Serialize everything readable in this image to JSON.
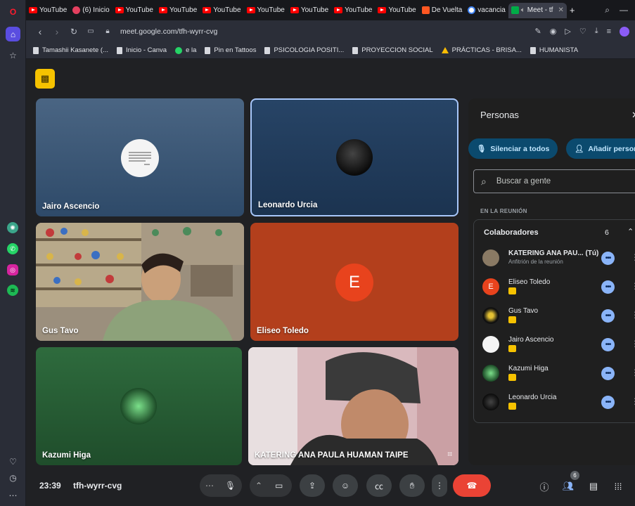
{
  "browser": {
    "tabs": [
      {
        "label": "YouTube",
        "kind": "youtube"
      },
      {
        "label": "(6) Inicio",
        "kind": "other"
      },
      {
        "label": "YouTube",
        "kind": "youtube"
      },
      {
        "label": "YouTube",
        "kind": "youtube"
      },
      {
        "label": "YouTube",
        "kind": "youtube"
      },
      {
        "label": "YouTube",
        "kind": "youtube"
      },
      {
        "label": "YouTube",
        "kind": "youtube"
      },
      {
        "label": "YouTube",
        "kind": "youtube"
      },
      {
        "label": "YouTube",
        "kind": "youtube"
      },
      {
        "label": "De Vuelta",
        "kind": "other"
      },
      {
        "label": "vacancia",
        "kind": "google"
      },
      {
        "label": "Meet - tf",
        "kind": "meet",
        "active": true
      }
    ],
    "url": "meet.google.com/tfh-wyrr-cvg",
    "bookmarks": [
      "Tamashii Kasanete (...",
      "Inicio - Canva",
      "e la",
      "Pin en Tattoos",
      "PSICOLOGIA POSITI...",
      "PROYECCION SOCIAL",
      "PRÁCTICAS - BRISA...",
      "HUMANISTA"
    ]
  },
  "meet": {
    "tiles": [
      {
        "name": "Jairo Ascencio"
      },
      {
        "name": "Leonardo Urcia"
      },
      {
        "name": "Gus Tavo"
      },
      {
        "name": "Eliseo Toledo",
        "initial": "E"
      },
      {
        "name": "Kazumi Higa"
      },
      {
        "name": "KATERING ANA PAULA HUAMAN TAIPE"
      }
    ],
    "people_panel": {
      "title": "Personas",
      "mute_all": "Silenciar a todos",
      "add_people": "Añadir person",
      "search_placeholder": "Buscar a gente",
      "section": "EN LA REUNIÓN",
      "group_label": "Colaboradores",
      "group_count": "6",
      "people": [
        {
          "name": "KATERING ANA PAU... (Tú)",
          "sub": "Anfitrión de la reunión"
        },
        {
          "name": "Eliseo Toledo",
          "initial": "E"
        },
        {
          "name": "Gus Tavo"
        },
        {
          "name": "Jairo Ascencio"
        },
        {
          "name": "Kazumi Higa"
        },
        {
          "name": "Leonardo Urcia"
        }
      ]
    },
    "bottom": {
      "time": "23:39",
      "meeting_code": "tfh-wyrr-cvg",
      "people_count": "6"
    }
  },
  "colors": {
    "end_call": "#ea4335",
    "accent_blue": "#8ab4f8",
    "eliseo_tile": "#b33f1c",
    "eliseo_avatar": "#e8431d"
  }
}
